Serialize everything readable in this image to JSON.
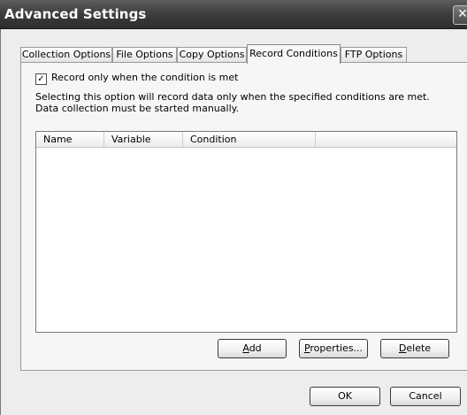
{
  "window": {
    "title": "Advanced Settings",
    "close_glyph": "✕"
  },
  "tabs": [
    {
      "label": "Collection Options"
    },
    {
      "label": "File Options"
    },
    {
      "label": "Copy Options"
    },
    {
      "label": "Record Conditions",
      "active": true
    },
    {
      "label": "FTP Options"
    }
  ],
  "record_conditions": {
    "checkbox": {
      "label": "Record only when the condition is met",
      "checked": true,
      "glyph": "✓"
    },
    "description": [
      "Selecting this option will record data only when the specified conditions are met.",
      "Data collection must be started manually."
    ],
    "list": {
      "columns": [
        "Name",
        "Variable",
        "Condition"
      ],
      "rows": []
    },
    "buttons": {
      "add": {
        "accel": "A",
        "rest": "dd"
      },
      "properties": {
        "accel": "P",
        "rest": "roperties..."
      },
      "delete": {
        "accel": "D",
        "rest": "elete"
      }
    }
  },
  "footer": {
    "ok_label": "OK",
    "cancel_label": "Cancel"
  },
  "icons": [
    "close-icon",
    "checkmark-icon"
  ]
}
